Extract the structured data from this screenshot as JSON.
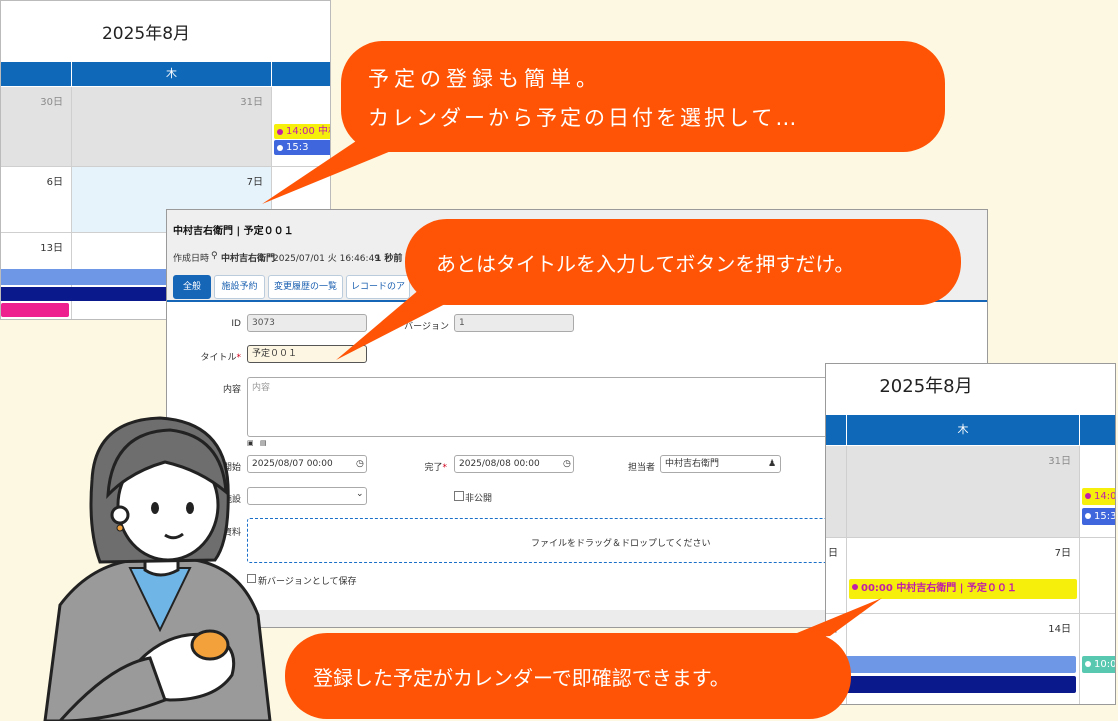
{
  "calendar_top": {
    "title": "2025年8月",
    "weekday": "木",
    "days": [
      "30日",
      "31日",
      "6日",
      "7日",
      "13日"
    ],
    "events": [
      "14:00 中村",
      "15:3"
    ]
  },
  "form": {
    "title": "中村吉右衛門 | 予定００１",
    "created_label": "作成日時",
    "created_user": "中村吉右衛門",
    "created_at": "2025/07/01 火 16:46:49",
    "ago": "1 秒前",
    "tabs": [
      "全般",
      "施設予約",
      "変更履歴の一覧",
      "レコードのア"
    ],
    "id_label": "ID",
    "id_value": "3073",
    "version_label": "バージョン",
    "version_value": "1",
    "title_label": "タイトル",
    "title_value": "予定００１",
    "body_label": "内容",
    "body_placeholder": "内容",
    "start_label": "開始",
    "start_value": "2025/08/07 00:00",
    "end_label": "完了",
    "end_value": "2025/08/08 00:00",
    "owner_label": "担当者",
    "owner_value": "中村吉右衛門",
    "facility_label": "施設",
    "private_label": "非公開",
    "attach_label": "資料",
    "drop_text": "ファイルをドラッグ＆ドロップしてください",
    "new_version_label": "新バージョンとして保存",
    "required_mark": "*"
  },
  "calendar_bottom": {
    "title": "2025年8月",
    "weekday": "木",
    "days": [
      "31日",
      "7日",
      "14日",
      "日",
      "日"
    ],
    "events": [
      "00:00 中村吉右衛門 | 予定００１",
      "14:0",
      "15:3",
      "10:0"
    ]
  },
  "bubbles": {
    "b1_line1": "予定の登録も簡単。",
    "b1_line2": "カレンダーから予定の日付を選択して…",
    "b2": "あとはタイトルを入力してボタンを押すだけ。",
    "b3": "登録した予定がカレンダーで即確認できます。"
  },
  "colors": {
    "accent": "#ff5405",
    "calendar_header": "#1069b8",
    "event_yellow": "#f6ef0b",
    "event_blue": "#3f66dc",
    "background": "#fdf8e1"
  }
}
